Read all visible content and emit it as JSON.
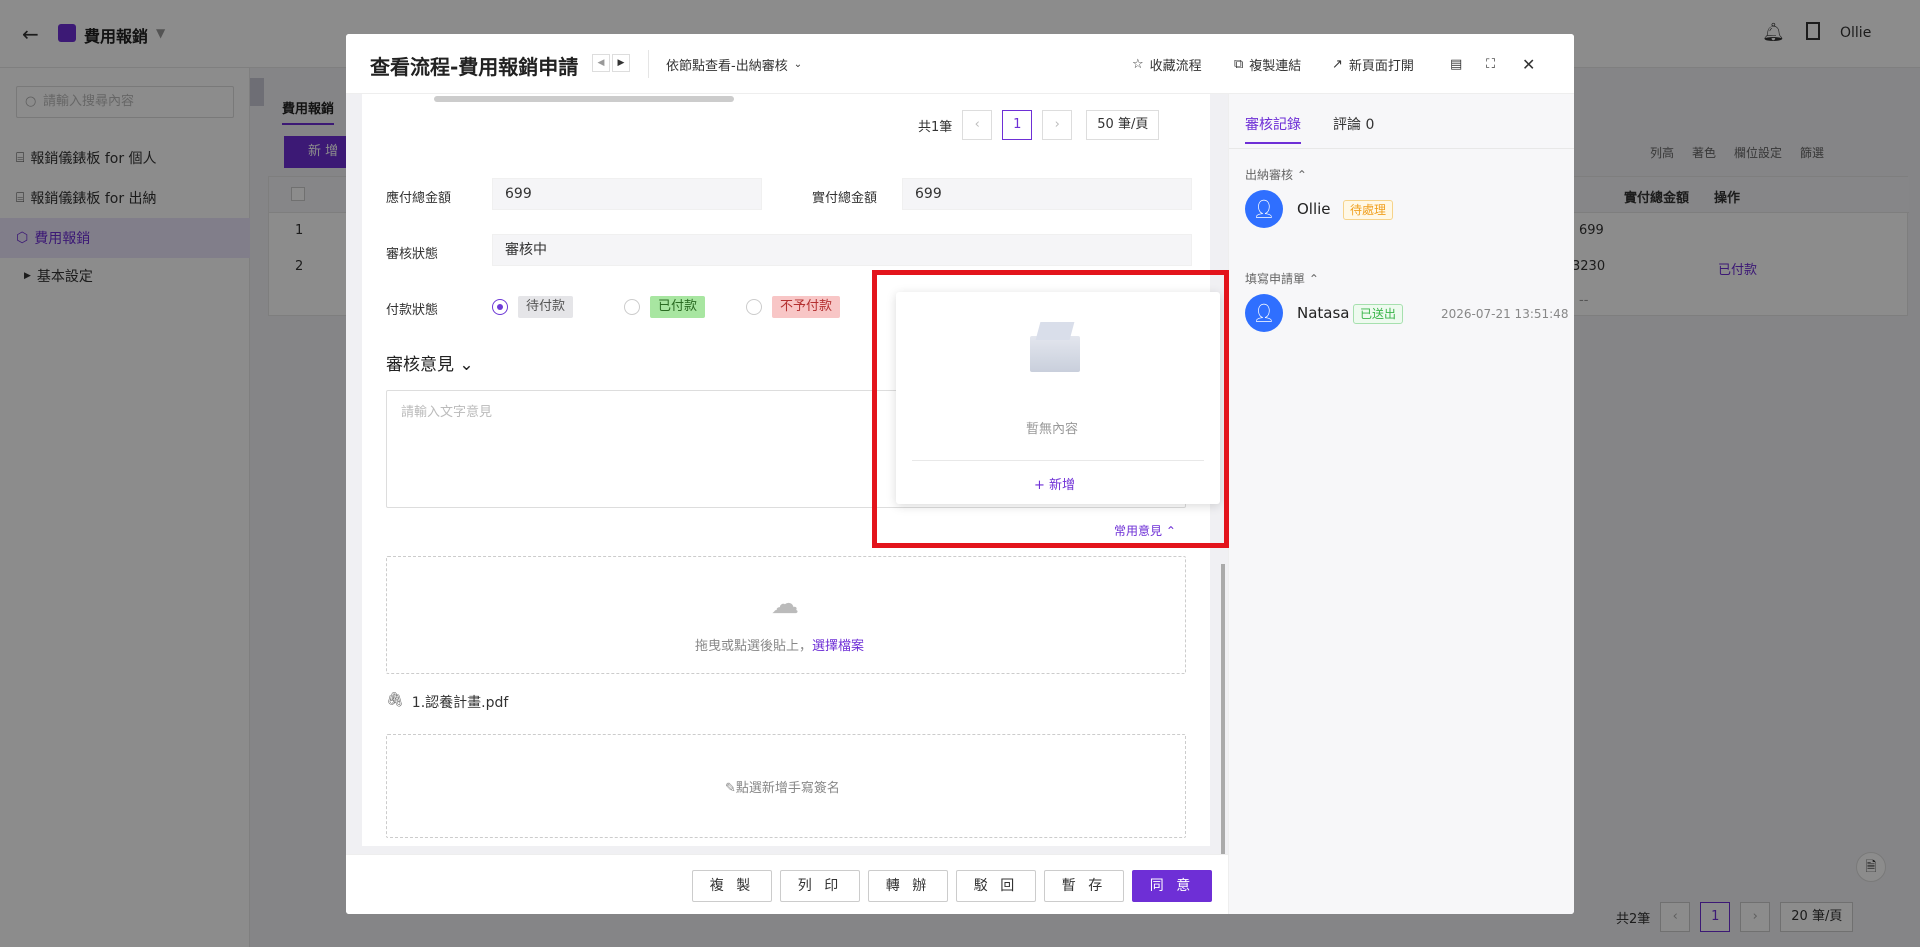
{
  "app": {
    "title": "費用報銷",
    "user": "Ollie",
    "search_placeholder": "請輸入搜尋內容",
    "sidebar": [
      {
        "label": "報銷儀錶板 for 個人"
      },
      {
        "label": "報銷儀錶板 for 出納"
      },
      {
        "label": "費用報銷"
      },
      {
        "label": "基本設定"
      }
    ],
    "tab": "費用報銷",
    "new_button": "新 增",
    "toolbar": [
      "列高",
      "著色",
      "欄位設定",
      "篩選"
    ],
    "table": {
      "headers": [
        "實付總金額",
        "操作"
      ],
      "rows": [
        {
          "no": "1",
          "amount": "699",
          "action": ""
        },
        {
          "no": "2",
          "amount": "3230",
          "action": "已付款"
        }
      ],
      "summary": "--"
    },
    "pager": {
      "total": "共2筆",
      "page": "1",
      "size": "20 筆/頁"
    }
  },
  "modal": {
    "title": "查看流程-費用報銷申請",
    "node_view": "依節點查看-出納審核",
    "actions": [
      "收藏流程",
      "複製連結",
      "新頁面打開"
    ],
    "sub_pager": {
      "total": "共1筆",
      "page": "1",
      "size": "50 筆/頁"
    },
    "fields": {
      "payable_label": "應付總金額",
      "payable_value": "699",
      "paid_label": "實付總金額",
      "paid_value": "699",
      "status_label": "審核狀態",
      "status_value": "審核中",
      "payment_label": "付款狀態"
    },
    "payment_options": [
      {
        "label": "待付款",
        "checked": true,
        "bg": "#e5e5e8",
        "color": "#555"
      },
      {
        "label": "已付款",
        "checked": false,
        "bg": "#a8e6a1",
        "color": "#2a6b22"
      },
      {
        "label": "不予付款",
        "checked": false,
        "bg": "#f8c6c6",
        "color": "#b43030"
      }
    ],
    "opinion_title": "審核意見",
    "opinion_placeholder": "請輸入文字意見",
    "common_opinion": "常用意見",
    "popup": {
      "empty": "暫無內容",
      "add": "+ 新增"
    },
    "upload": {
      "hint": "拖曳或點選後貼上，",
      "link": "選擇檔案"
    },
    "attachment": "1.認養計畫.pdf",
    "signature": "點選新增手寫簽名",
    "footer_buttons": [
      "複 製",
      "列 印",
      "轉 辦",
      "駁 回",
      "暫 存",
      "同 意"
    ]
  },
  "review": {
    "tabs": [
      "審核記錄",
      "評論 0"
    ],
    "sections": [
      {
        "title": "出納審核",
        "user": "Ollie",
        "status": "待處理",
        "status_color": "#f0a020",
        "time": ""
      },
      {
        "title": "填寫申請單",
        "user": "Natasa",
        "status": "已送出",
        "status_color": "#3bb54a",
        "time": "2026-07-21 13:51:48"
      }
    ]
  },
  "colors": {
    "accent": "#6e2fd6",
    "highlight": "#e3141c"
  }
}
